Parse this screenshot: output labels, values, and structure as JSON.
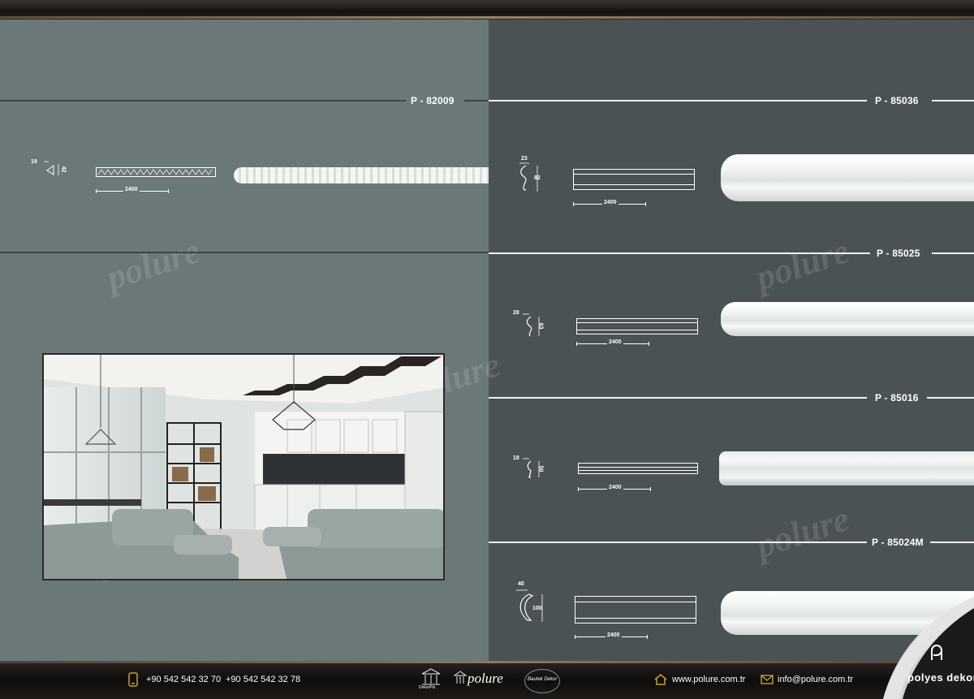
{
  "products": [
    {
      "code": "P - 82009",
      "width_dim": "19",
      "height_dim": "42",
      "length_dim": "2400"
    },
    {
      "code": "P - 85036",
      "width_dim": "23",
      "height_dim": "82",
      "length_dim": "2400"
    },
    {
      "code": "P - 85025",
      "width_dim": "28",
      "height_dim": "63",
      "length_dim": "2400"
    },
    {
      "code": "P - 85016",
      "width_dim": "18",
      "height_dim": "50",
      "length_dim": "2400"
    },
    {
      "code": "P - 85024M",
      "width_dim": "40",
      "height_dim": "100",
      "length_dim": "2400"
    }
  ],
  "watermark": "polure",
  "footer": {
    "phone1": "+90 542 542 32 70",
    "phone2": "+90 542 542 32 78",
    "website": "www.polure.com.tr",
    "email": "info@polure.com.tr",
    "logos": [
      "DekorPix",
      "polure",
      "Bautek Dekor"
    ]
  },
  "brand": {
    "name": "polyes dekor"
  },
  "colors": {
    "left_panel": "#6b7878",
    "right_panel": "#4b5254",
    "footer": "#0e0d0c",
    "accent_gold": "#c9a227"
  },
  "icons": {
    "phone": "phone-icon",
    "home": "home-icon",
    "mail": "mail-icon"
  }
}
